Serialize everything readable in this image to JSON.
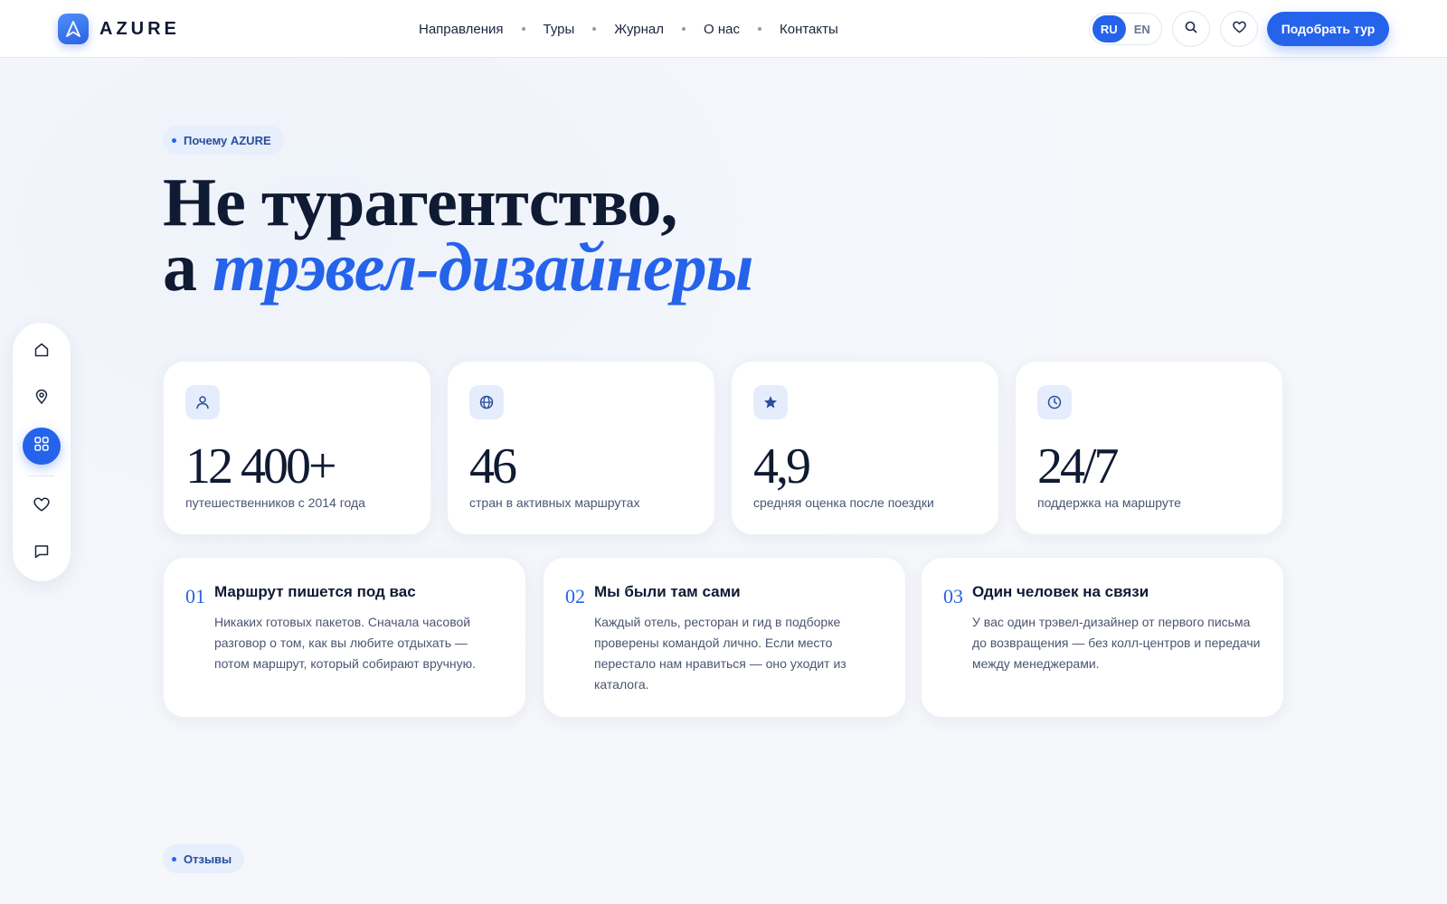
{
  "brand": {
    "name": "AZURE"
  },
  "nav": {
    "items": [
      {
        "label": "Направления"
      },
      {
        "label": "Туры"
      },
      {
        "label": "Журнал"
      },
      {
        "label": "О нас"
      },
      {
        "label": "Контакты"
      }
    ]
  },
  "header": {
    "languages": [
      {
        "label": "RU",
        "active": true
      },
      {
        "label": "EN",
        "active": false
      }
    ],
    "cta_label": "Подобрать тур"
  },
  "sidebar": {
    "icons": [
      "home-icon",
      "map-pin-icon",
      "grid-icon",
      "heart-icon",
      "chat-icon"
    ]
  },
  "why": {
    "badge": "Почему AZURE",
    "title_line1": "Не турагентство,",
    "title_line2_prefix": "а",
    "title_line2_accent": "трэвел-дизайнеры"
  },
  "stats": [
    {
      "icon": "user-icon",
      "value": "12 400+",
      "label": "путешественников с 2014 года"
    },
    {
      "icon": "globe-icon",
      "value": "46",
      "label": "стран в активных маршрутах"
    },
    {
      "icon": "star-icon",
      "value": "4,9",
      "label": "средняя оценка после поездки"
    },
    {
      "icon": "clock-icon",
      "value": "24/7",
      "label": "поддержка на маршруте"
    }
  ],
  "features": [
    {
      "num": "01",
      "title": "Маршрут пишется под вас",
      "text": "Никаких готовых пакетов. Сначала часовой разговор о том, как вы любите отдыхать — потом маршрут, который собирают вручную."
    },
    {
      "num": "02",
      "title": "Мы были там сами",
      "text": "Каждый отель, ресторан и гид в подборке проверены командой лично. Если место перестало нам нравиться — оно уходит из каталога."
    },
    {
      "num": "03",
      "title": "Один человек на связи",
      "text": "У вас один трэвел-дизайнер от первого письма до возвращения — без колл-центров и передачи между менеджерами."
    }
  ],
  "reviews": {
    "badge": "Отзывы"
  },
  "colors": {
    "accent": "#2563eb",
    "ink": "#0f1a33",
    "muted": "#4a5570"
  }
}
